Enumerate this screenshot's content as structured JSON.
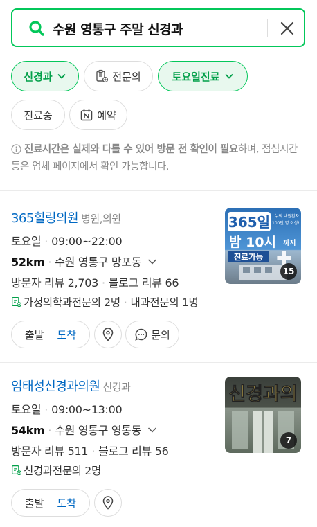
{
  "search": {
    "query": "수원 영통구 주말 신경과"
  },
  "filters": {
    "chip1": "신경과",
    "chip2": "전문의",
    "chip3": "토요일진료",
    "chip4": "진료중",
    "chip5": "예약"
  },
  "notice": {
    "bold": "진료시간은 실제와 다를 수 있어 방문 전 확인이 필요",
    "rest": "하며, 점심시간 등은 업체 페이지에서 확인 가능합니다."
  },
  "colors": {
    "accent": "#03c75a",
    "link": "#0068c3"
  },
  "results": [
    {
      "name": "365힐링의원",
      "category": "병원,의원",
      "day": "토요일",
      "hours": "09:00~22:00",
      "distance": "52km",
      "address": "수원 영통구 망포동",
      "visitor_reviews": "방문자 리뷰 2,703",
      "blog_reviews": "블로그 리뷰 66",
      "specialists_1": "가정의학과전문의 2명",
      "specialists_2": "내과전문의 1명",
      "photo_count": "15",
      "photo_text_1": "365일",
      "photo_text_2": "밤 10시",
      "photo_text_2b": "까지",
      "photo_text_3": "진료가능",
      "photo_small_1": "누적 내원환자",
      "photo_small_2": "100만 명 이상!",
      "btn_depart": "출발",
      "btn_arrive": "도착",
      "btn_inquiry": "문의"
    },
    {
      "name": "임태성신경과의원",
      "category": "신경과",
      "day": "토요일",
      "hours": "09:00~13:00",
      "distance": "54km",
      "address": "수원 영통구 영통동",
      "visitor_reviews": "방문자 리뷰 511",
      "blog_reviews": "블로그 리뷰 56",
      "specialists_1": "신경과전문의 2명",
      "photo_count": "7",
      "photo_text_1": "신경과의",
      "btn_depart": "출발",
      "btn_arrive": "도착"
    }
  ]
}
